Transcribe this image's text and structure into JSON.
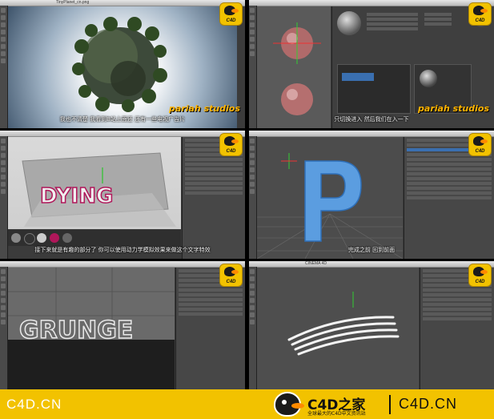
{
  "panels": [
    {
      "window_title": "TinyPlanet_cn.png",
      "subtitle": "我也不清楚 我看到B站上面还 还有一些电视广告片",
      "watermark": "pariah studios"
    },
    {
      "window_title": "",
      "subtitle": "只切换进入 然后我们在入一下",
      "watermark": "pariah studios"
    },
    {
      "window_title": "",
      "subtitle": "接下来就是有趣的部分了 你可以使用动力学模拟效果来做这个文字特效"
    },
    {
      "window_title": "",
      "subtitle": "完成之前 回到前面"
    },
    {
      "window_title": "",
      "subtitle": ""
    },
    {
      "window_title": "CINEMA 4D",
      "subtitle": ""
    }
  ],
  "viewport_text": {
    "dying": "DYING",
    "grunge": "GRUNGE"
  },
  "badge_text": "C4D",
  "footer": {
    "left": "C4D.CN",
    "brand": "C4D之家",
    "tagline": "全球最大的C4D中文资讯站",
    "right": "C4D.CN"
  },
  "colors": {
    "brand_yellow": "#f2c200",
    "beak_orange": "#ff8a00"
  }
}
